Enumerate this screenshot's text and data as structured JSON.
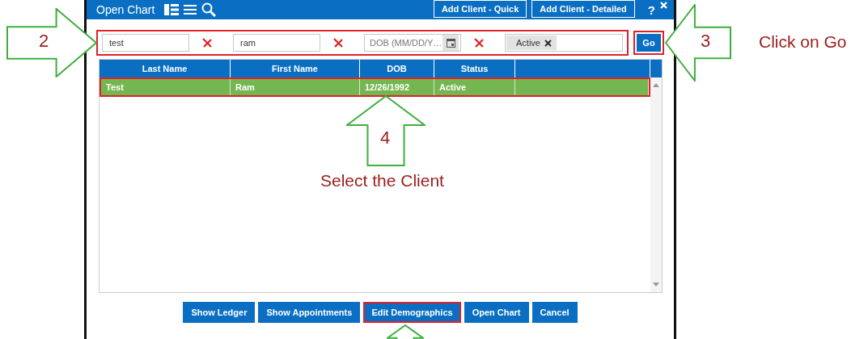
{
  "window": {
    "title": "Open Chart"
  },
  "header_buttons": [
    "Add Client - Quick",
    "Add Client - Detailed"
  ],
  "help": "?",
  "filters": {
    "highlighted": true,
    "fields": [
      {
        "kind": "text",
        "value": "test"
      },
      {
        "kind": "text",
        "value": "ram"
      },
      {
        "kind": "date",
        "placeholder": "DOB (MM/DD/Y…"
      },
      {
        "kind": "tags",
        "tags": [
          "Active"
        ]
      }
    ]
  },
  "go_button": {
    "label": "Go",
    "highlighted": true
  },
  "table": {
    "columns": [
      "Last Name",
      "First Name",
      "DOB",
      "Status"
    ],
    "rows": [
      {
        "cells": [
          "Test",
          "Ram",
          "12/26/1992",
          "Active"
        ],
        "selected": true,
        "highlighted": true
      }
    ]
  },
  "buttons": [
    {
      "label": "Show Ledger",
      "highlighted": false
    },
    {
      "label": "Show Appointments",
      "highlighted": false
    },
    {
      "label": "Edit Demographics",
      "highlighted": true
    },
    {
      "label": "Open Chart",
      "highlighted": false
    },
    {
      "label": "Cancel",
      "highlighted": false
    }
  ],
  "annotations": [
    {
      "kind": "right",
      "number": "2"
    },
    {
      "kind": "left",
      "number": "3",
      "caption": "Click on Go"
    },
    {
      "kind": "up",
      "number": "4",
      "caption": "Select the Client"
    },
    {
      "kind": "up"
    }
  ]
}
